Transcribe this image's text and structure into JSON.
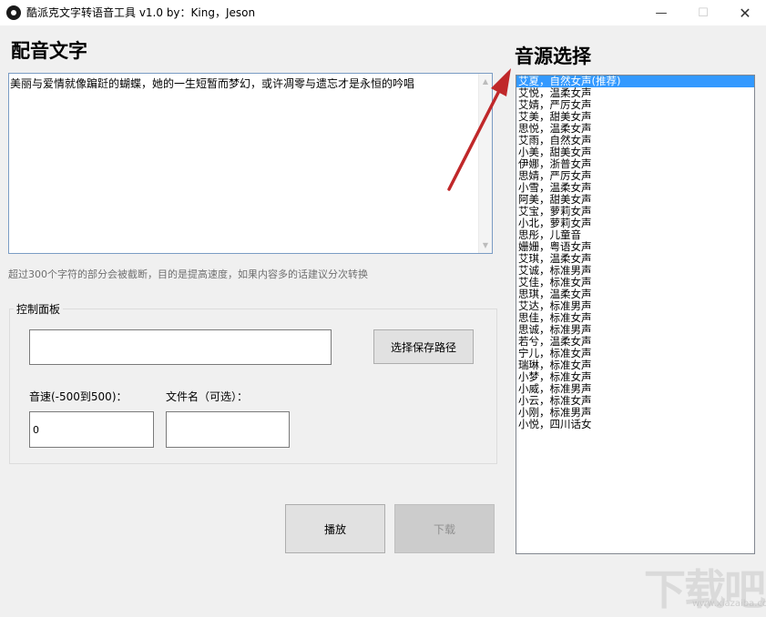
{
  "window": {
    "title": "酷派克文字转语音工具 v1.0 by：King，Jeson",
    "minimize_glyph": "—",
    "maximize_glyph": "☐",
    "close_glyph": "✕"
  },
  "left": {
    "heading": "配音文字",
    "text_value": "美丽与爱情就像蹁跹的蝴蝶，她的一生短暂而梦幻，或许凋零与遗忘才是永恒的吟唱",
    "hint": "超过300个字符的部分会被截断，目的是提高速度，如果内容多的话建议分次转换"
  },
  "control_panel": {
    "legend": "控制面板",
    "save_path_value": "",
    "choose_path_label": "选择保存路径",
    "speed_label": "音速(-500到500)：",
    "speed_value": "0",
    "filename_label": "文件名（可选）：",
    "filename_value": "",
    "play_label": "播放",
    "download_label": "下载"
  },
  "voices": {
    "heading": "音源选择",
    "selected_index": 0,
    "items": [
      "艾夏，自然女声(推荐)",
      "艾悦，温柔女声",
      "艾婧，严厉女声",
      "艾美，甜美女声",
      "思悦，温柔女声",
      "艾雨，自然女声",
      "小美，甜美女声",
      "伊娜，浙普女声",
      "思婧，严厉女声",
      "小雪，温柔女声",
      "阿美，甜美女声",
      "艾宝，萝莉女声",
      "小北，萝莉女声",
      "思彤，儿童音",
      "姗姗，粤语女声",
      "艾琪，温柔女声",
      "艾诚，标准男声",
      "艾佳，标准女声",
      "思琪，温柔女声",
      "艾达，标准男声",
      "思佳，标准女声",
      "思诚，标准男声",
      "若兮，温柔女声",
      "宁儿，标准女声",
      "瑞琳，标准女声",
      "小梦，标准女声",
      "小威，标准男声",
      "小云，标准女声",
      "小刚，标准男声",
      "小悦，四川话女"
    ]
  },
  "watermark": {
    "text": "下载吧",
    "sub": "www.xiazaiba.com"
  },
  "colors": {
    "selection": "#3399ff",
    "annotation_arrow": "#c0282a"
  }
}
